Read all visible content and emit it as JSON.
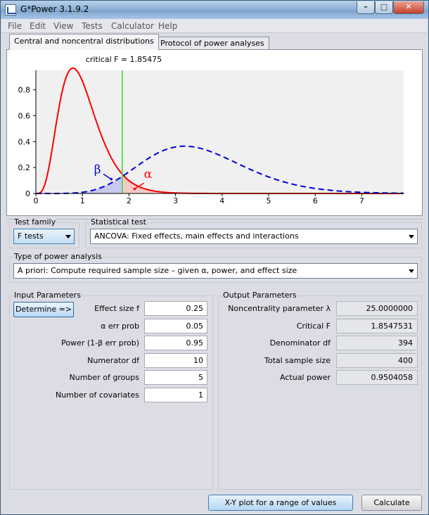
{
  "window": {
    "title": "G*Power 3.1.9.2"
  },
  "menu": [
    "File",
    "Edit",
    "View",
    "Tests",
    "Calculator",
    "Help"
  ],
  "tabs": [
    {
      "label": "Central and noncentral distributions",
      "active": true
    },
    {
      "label": "Protocol of power analyses",
      "active": false
    }
  ],
  "plot": {
    "critical_label": "critical F = 1.85475",
    "critical_value": 1.85475,
    "x_ticks": [
      "0",
      "1",
      "2",
      "3",
      "4",
      "5",
      "6",
      "7"
    ],
    "y_ticks": [
      "0",
      "0.2",
      "0.4",
      "0.6",
      "0.8"
    ],
    "beta_label": "β",
    "alpha_label": "α",
    "xlim": [
      0,
      7.9
    ],
    "ylim": [
      0,
      0.95
    ],
    "central_color": "#ff0000",
    "noncentral_color": "#0000dd",
    "critical_color": "#33dd33",
    "df1": 10,
    "df2": 394,
    "lambda": 25
  },
  "test_family": {
    "title": "Test family",
    "value": "F tests"
  },
  "statistical_test": {
    "title": "Statistical test",
    "value": "ANCOVA: Fixed effects, main effects and interactions"
  },
  "power_analysis": {
    "title": "Type of power analysis",
    "value": "A priori: Compute required sample size – given α, power, and effect size"
  },
  "input": {
    "title": "Input Parameters",
    "determine_label": "Determine =>",
    "params": [
      {
        "label": "Effect size f",
        "value": "0.25"
      },
      {
        "label": "α err prob",
        "value": "0.05"
      },
      {
        "label": "Power (1-β err prob)",
        "value": "0.95"
      },
      {
        "label": "Numerator df",
        "value": "10"
      },
      {
        "label": "Number of groups",
        "value": "5"
      },
      {
        "label": "Number of covariates",
        "value": "1"
      }
    ]
  },
  "output": {
    "title": "Output Parameters",
    "params": [
      {
        "label": "Noncentrality parameter λ",
        "value": "25.0000000"
      },
      {
        "label": "Critical F",
        "value": "1.8547531"
      },
      {
        "label": "Denominator df",
        "value": "394"
      },
      {
        "label": "Total sample size",
        "value": "400"
      },
      {
        "label": "Actual power",
        "value": "0.9504058"
      }
    ]
  },
  "buttons": {
    "xy_plot": "X-Y plot for a range of values",
    "calculate": "Calculate"
  }
}
